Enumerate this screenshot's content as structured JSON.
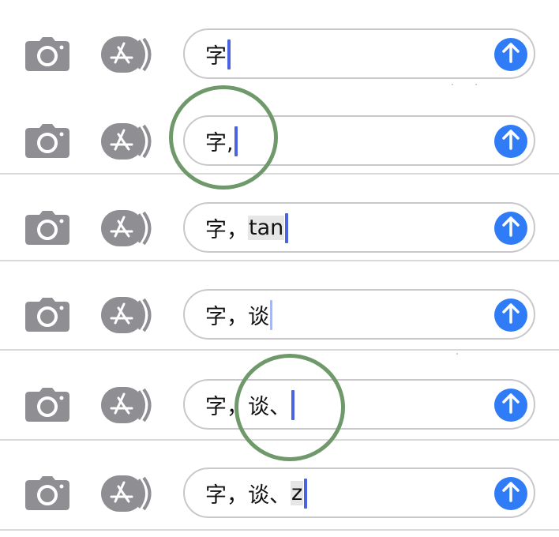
{
  "rows": [
    {
      "before": "字",
      "marked": "",
      "caret": "strong"
    },
    {
      "before": "字,",
      "marked": "",
      "caret": "strong"
    },
    {
      "before": "字，",
      "marked": "tan",
      "caret": "strong"
    },
    {
      "before": "字，谈",
      "marked": "",
      "caret": "light"
    },
    {
      "before": "字，谈、",
      "marked": "",
      "caret": "strong"
    },
    {
      "before": "字，谈、",
      "marked": "z",
      "caret": "strong"
    }
  ],
  "icons": {
    "camera": "camera-icon",
    "apps": "app-store-icon",
    "send": "send-arrow-up-icon"
  },
  "colors": {
    "icon_gray": "#8e8e93",
    "send_blue": "#2f7cf6",
    "caret": "#4a63e0",
    "annotation_circle": "#6f996a"
  }
}
